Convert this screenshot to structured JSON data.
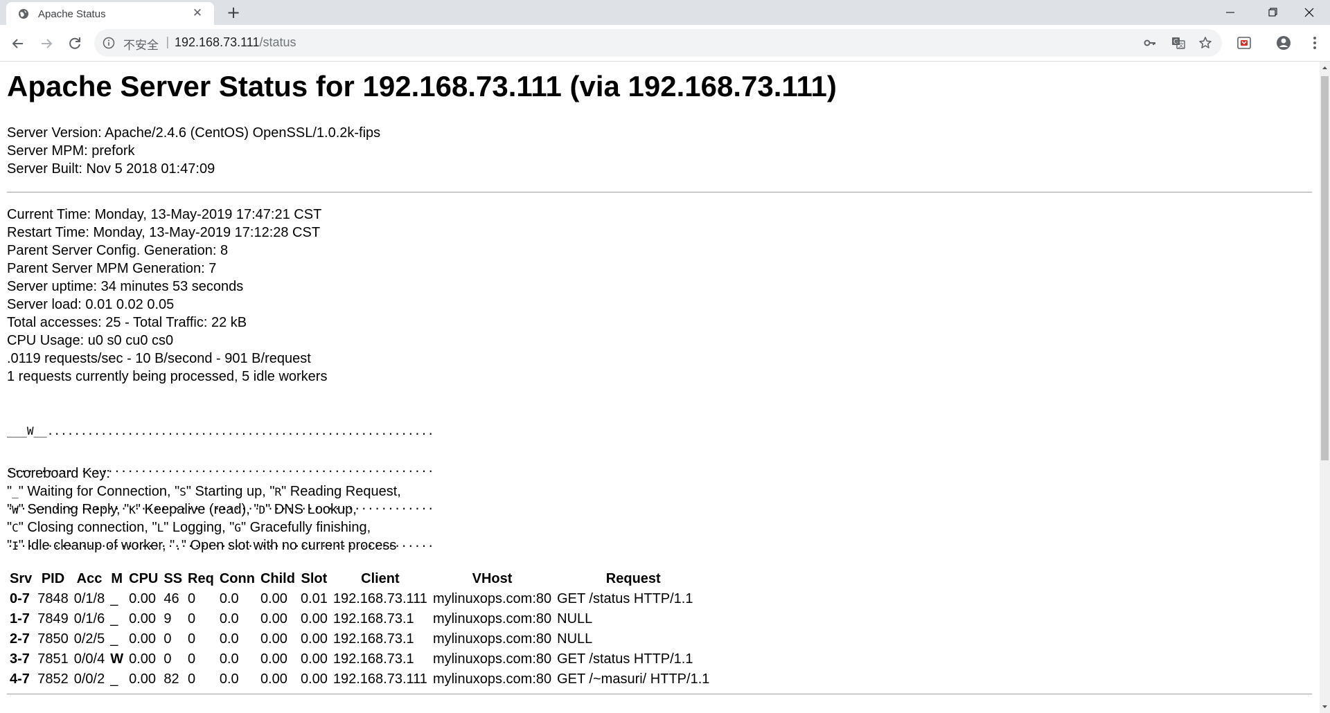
{
  "browser": {
    "tab_title": "Apache Status",
    "security_label": "不安全",
    "url_host": "192.168.73.111",
    "url_path": "/status",
    "icons": [
      "globe-icon",
      "close-icon",
      "plus-icon",
      "minimize-icon",
      "maximize-icon",
      "window-close-icon",
      "back-arrow-icon",
      "forward-arrow-icon",
      "reload-icon",
      "info-icon",
      "key-icon",
      "translate-icon",
      "star-icon",
      "extension-icon",
      "account-icon",
      "menu-dots-icon"
    ]
  },
  "page": {
    "title": "Apache Server Status for 192.168.73.111 (via 192.168.73.111)",
    "server_info": [
      "Server Version: Apache/2.4.6 (CentOS) OpenSSL/1.0.2k-fips",
      "Server MPM: prefork",
      "Server Built: Nov 5 2018 01:47:09"
    ],
    "status_info": [
      "Current Time: Monday, 13-May-2019 17:47:21 CST",
      "Restart Time: Monday, 13-May-2019 17:12:28 CST",
      "Parent Server Config. Generation: 8",
      "Parent Server MPM Generation: 7",
      "Server uptime: 34 minutes 53 seconds",
      "Server load: 0.01 0.02 0.05",
      "Total accesses: 25 - Total Traffic: 22 kB",
      "CPU Usage: u0 s0 cu0 cs0",
      ".0119 requests/sec - 10 B/second - 901 B/request",
      "1 requests currently being processed, 5 idle workers"
    ],
    "scoreboard": [
      "___W__..........................................................",
      "................................................................",
      "................................................................",
      "................................................................"
    ],
    "key_title": "Scoreboard Key:",
    "key_lines": [
      [
        {
          "t": "\""
        },
        {
          "m": "_"
        },
        {
          "t": "\" Waiting for Connection, \""
        },
        {
          "m": "S"
        },
        {
          "t": "\" Starting up, \""
        },
        {
          "m": "R"
        },
        {
          "t": "\" Reading Request,"
        }
      ],
      [
        {
          "t": "\""
        },
        {
          "m": "W"
        },
        {
          "t": "\" Sending Reply, \""
        },
        {
          "m": "K"
        },
        {
          "t": "\" Keepalive (read), \""
        },
        {
          "m": "D"
        },
        {
          "t": "\" DNS Lookup,"
        }
      ],
      [
        {
          "t": "\""
        },
        {
          "m": "C"
        },
        {
          "t": "\" Closing connection, \""
        },
        {
          "m": "L"
        },
        {
          "t": "\" Logging, \""
        },
        {
          "m": "G"
        },
        {
          "t": "\" Gracefully finishing,"
        }
      ],
      [
        {
          "t": "\""
        },
        {
          "m": "I"
        },
        {
          "t": "\" Idle cleanup of worker, \""
        },
        {
          "m": "."
        },
        {
          "t": "\" Open slot with no current process"
        }
      ]
    ],
    "table_headers": [
      "Srv",
      "PID",
      "Acc",
      "M",
      "CPU",
      "SS",
      "Req",
      "Conn",
      "Child",
      "Slot",
      "Client",
      "VHost",
      "Request"
    ],
    "table_rows": [
      [
        "0-7",
        "7848",
        "0/1/8",
        "_",
        "0.00",
        "46",
        "0",
        "0.0",
        "0.00",
        "0.01",
        "192.168.73.111",
        "mylinuxops.com:80",
        "GET /status HTTP/1.1"
      ],
      [
        "1-7",
        "7849",
        "0/1/6",
        "_",
        "0.00",
        "9",
        "0",
        "0.0",
        "0.00",
        "0.00",
        "192.168.73.1",
        "mylinuxops.com:80",
        "NULL"
      ],
      [
        "2-7",
        "7850",
        "0/2/5",
        "_",
        "0.00",
        "0",
        "0",
        "0.0",
        "0.00",
        "0.00",
        "192.168.73.1",
        "mylinuxops.com:80",
        "NULL"
      ],
      [
        "3-7",
        "7851",
        "0/0/4",
        "W",
        "0.00",
        "0",
        "0",
        "0.0",
        "0.00",
        "0.00",
        "192.168.73.1",
        "mylinuxops.com:80",
        "GET /status HTTP/1.1"
      ],
      [
        "4-7",
        "7852",
        "0/0/2",
        "_",
        "0.00",
        "82",
        "0",
        "0.0",
        "0.00",
        "0.00",
        "192.168.73.111",
        "mylinuxops.com:80",
        "GET /~masuri/ HTTP/1.1"
      ]
    ]
  }
}
